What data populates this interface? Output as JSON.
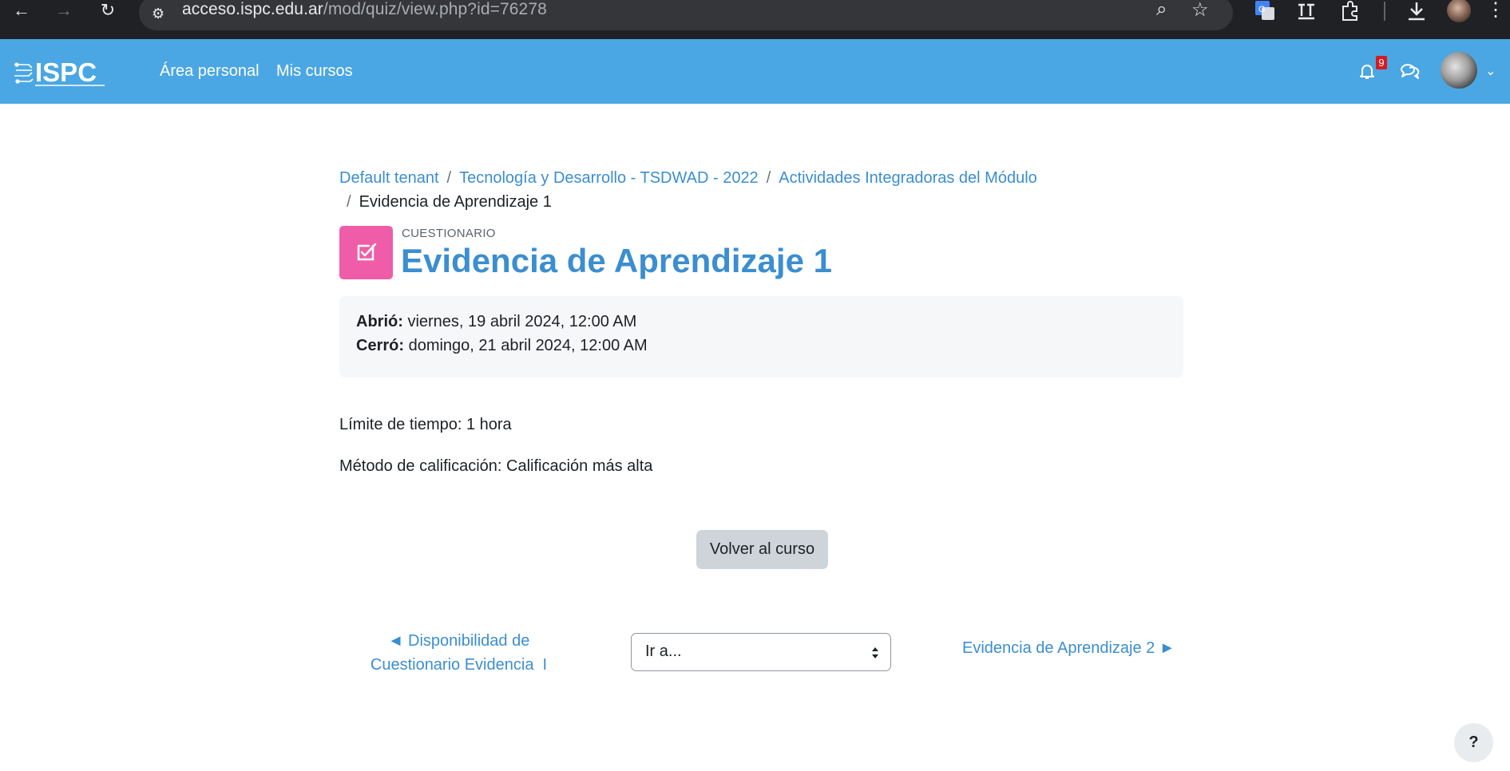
{
  "browser": {
    "url_host": "acceso.ispc.edu.ar",
    "url_path": "/mod/quiz/view.php?id=76278"
  },
  "navbar": {
    "logo_text": "ISPC",
    "links": [
      "Área personal",
      "Mis cursos"
    ],
    "notification_count": "9"
  },
  "breadcrumb": {
    "items": [
      "Default tenant",
      "Tecnología y Desarrollo - TSDWAD - 2022",
      "Actividades Integradoras del Módulo",
      "Evidencia de Aprendizaje 1"
    ],
    "separator": "/"
  },
  "activity": {
    "type_label": "CUESTIONARIO",
    "title": "Evidencia de Aprendizaje 1",
    "icon": "quiz-checkbox-icon",
    "icon_color": "#ef5da8"
  },
  "dates": {
    "opened_label": "Abrió:",
    "opened_value": "viernes, 19 abril 2024, 12:00 AM",
    "closed_label": "Cerró:",
    "closed_value": "domingo, 21 abril 2024, 12:00 AM"
  },
  "info": {
    "time_limit": "Límite de tiempo: 1 hora",
    "grading_method": "Método de calificación: Calificación más alta"
  },
  "actions": {
    "back_button": "Volver al curso"
  },
  "activity_nav": {
    "prev_line1": "◄ Disponibilidad de",
    "prev_line2": "Cuestionario Evidencia  I",
    "jump_selected": "Ir a...",
    "next": "Evidencia de Aprendizaje 2 ►"
  },
  "help_button": "?",
  "colors": {
    "navbar": "#4aa7e3",
    "link": "#3b8ed0",
    "chrome": "#202124"
  }
}
